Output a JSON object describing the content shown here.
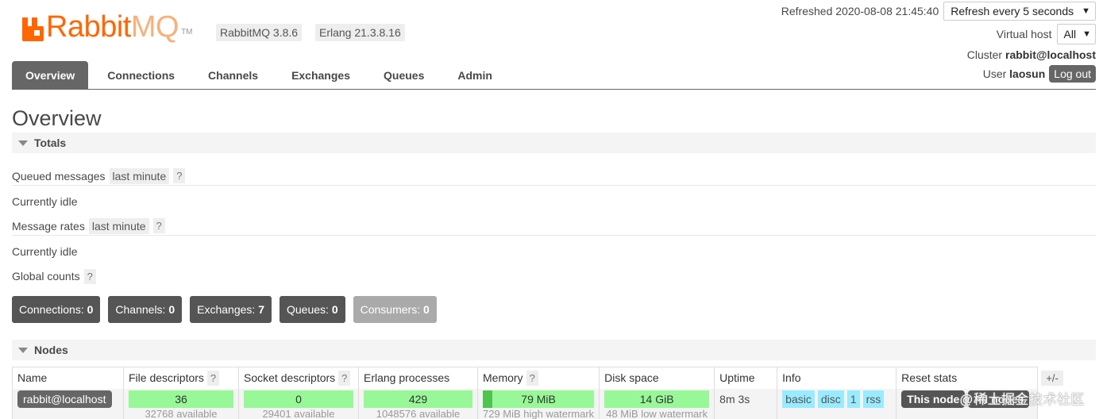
{
  "header": {
    "logo_rabbit": "Rabbit",
    "logo_mq": "MQ",
    "logo_tm": "TM",
    "rabbitmq_version": "RabbitMQ 3.8.6",
    "erlang_version": "Erlang 21.3.8.16",
    "refreshed": "Refreshed 2020-08-08 21:45:40",
    "refresh_select": "Refresh every 5 seconds",
    "virtual_host_label": "Virtual host",
    "virtual_host_value": "All",
    "cluster_label": "Cluster",
    "cluster_name": "rabbit@localhost",
    "user_label": "User",
    "user_name": "laosun",
    "logout": "Log out"
  },
  "tabs": [
    {
      "label": "Overview",
      "active": true
    },
    {
      "label": "Connections"
    },
    {
      "label": "Channels"
    },
    {
      "label": "Exchanges"
    },
    {
      "label": "Queues"
    },
    {
      "label": "Admin"
    }
  ],
  "page_title": "Overview",
  "totals": {
    "header": "Totals",
    "queued_messages_label": "Queued messages",
    "queued_messages_range": "last minute",
    "help": "?",
    "idle_1": "Currently idle",
    "message_rates_label": "Message rates",
    "message_rates_range": "last minute",
    "idle_2": "Currently idle",
    "global_counts_label": "Global counts"
  },
  "counts": [
    {
      "label": "Connections:",
      "value": "0"
    },
    {
      "label": "Channels:",
      "value": "0"
    },
    {
      "label": "Exchanges:",
      "value": "7"
    },
    {
      "label": "Queues:",
      "value": "0"
    },
    {
      "label": "Consumers:",
      "value": "0"
    }
  ],
  "nodes": {
    "header": "Nodes",
    "columns": {
      "name": "Name",
      "file_descriptors": "File descriptors",
      "socket_descriptors": "Socket descriptors",
      "erlang_processes": "Erlang processes",
      "memory": "Memory",
      "disk_space": "Disk space",
      "uptime": "Uptime",
      "info": "Info",
      "reset_stats": "Reset stats",
      "plus_minus": "+/-"
    },
    "row": {
      "name": "rabbit@localhost",
      "file_descriptors": "36",
      "file_descriptors_sub": "32768 available",
      "socket_descriptors": "0",
      "socket_descriptors_sub": "29401 available",
      "erlang_processes": "429",
      "erlang_processes_sub": "1048576 available",
      "memory": "79 MiB",
      "memory_sub": "729 MiB high watermark",
      "disk_space": "14 GiB",
      "disk_space_sub": "48 MiB low watermark",
      "uptime": "8m 3s",
      "info_tags": [
        "basic",
        "disc",
        "1",
        "rss"
      ],
      "reset_this_node": "This node",
      "reset_all_nodes": "All nodes"
    }
  },
  "watermark": "@稀土掘金技术社区",
  "colors": {
    "logo_orange": "#ff6600",
    "tab_active": "#666666",
    "bar_green": "#98f898",
    "info_blue": "#99ebff"
  }
}
